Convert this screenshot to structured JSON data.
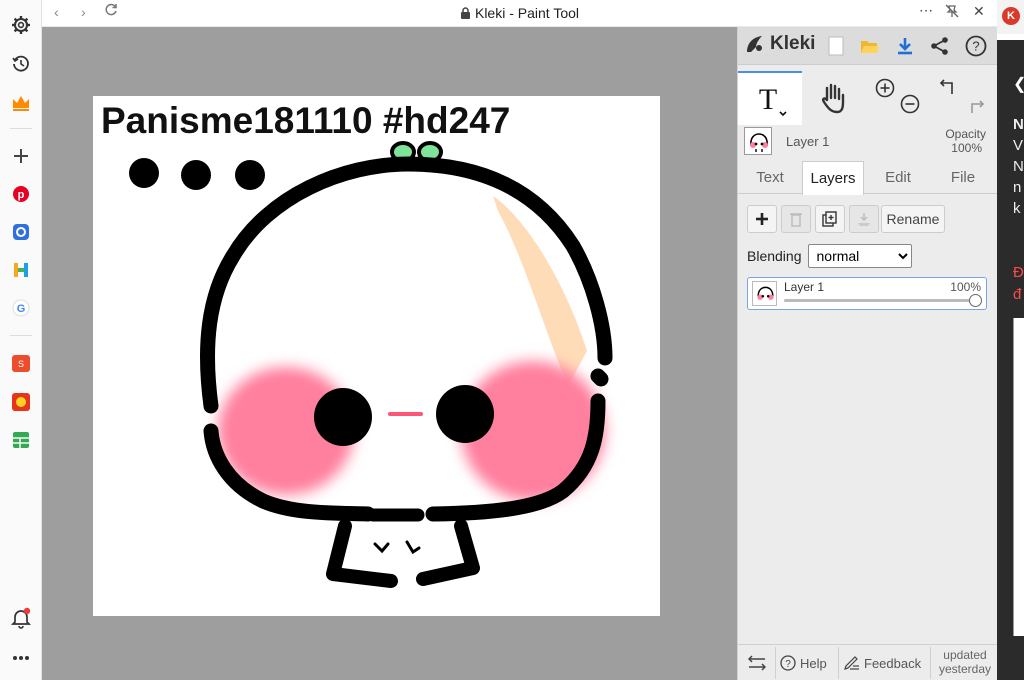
{
  "window": {
    "title": "Kleki - Paint Tool",
    "lock_icon": "lock-icon"
  },
  "rail": {
    "items": [
      "gear-icon",
      "history-icon",
      "crown-icon",
      "plus-icon",
      "pinterest-icon",
      "app-icon",
      "h-icon",
      "google-icon",
      "shopee-icon",
      "game-icon",
      "sheet-icon",
      "bell-icon",
      "more-icon"
    ],
    "accent": "#ff8a00"
  },
  "canvas": {
    "text": "Panisme181110 #hd247",
    "colors": {
      "blush": "#ff7f9e",
      "skin": "#ffdcb8",
      "leaf": "#7fe39a",
      "ink": "#000000"
    }
  },
  "panel": {
    "brand": "Kleki",
    "layer_name": "Layer 1",
    "opacity_label": "Opacity",
    "opacity_value": "100%",
    "tabs": [
      "Text",
      "Layers",
      "Edit",
      "File"
    ],
    "active_tab": "Layers",
    "rename_label": "Rename",
    "blending_label": "Blending",
    "blending_value": "normal",
    "layer_row": {
      "name": "Layer 1",
      "opacity": "100%",
      "opacity_fraction": 1.0
    },
    "footer": {
      "help": "Help",
      "feedback": "Feedback",
      "updated_1": "updated",
      "updated_2": "yesterday"
    },
    "accent": "#1e6fd9"
  },
  "bgpage": {
    "lines": [
      "N",
      "V",
      "N",
      "n",
      "k"
    ],
    "red_lines": [
      "Đ",
      "đ"
    ]
  }
}
